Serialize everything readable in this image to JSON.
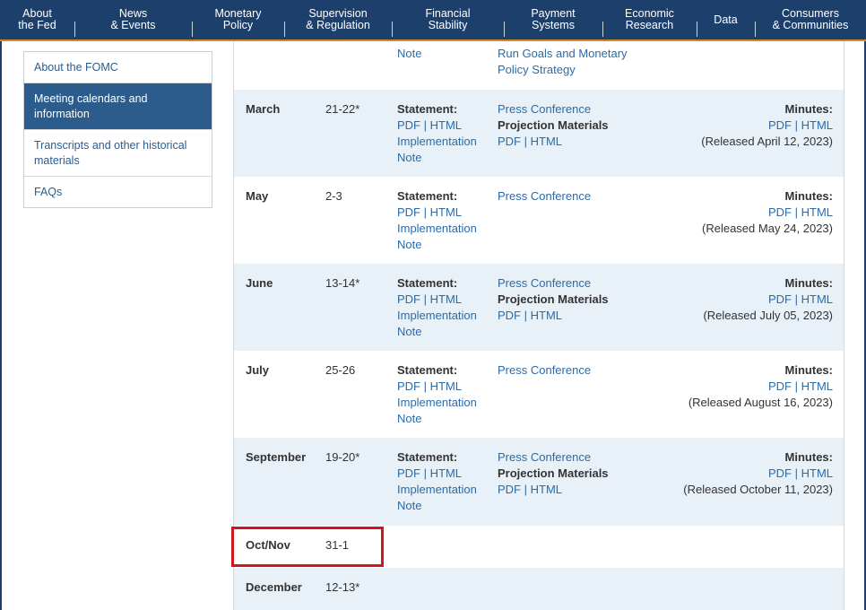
{
  "nav": [
    {
      "label": "About\nthe Fed"
    },
    {
      "label": "News\n& Events"
    },
    {
      "label": "Monetary\nPolicy"
    },
    {
      "label": "Supervision\n& Regulation"
    },
    {
      "label": "Financial\nStability"
    },
    {
      "label": "Payment\nSystems"
    },
    {
      "label": "Economic\nResearch"
    },
    {
      "label": "Data"
    },
    {
      "label": "Consumers\n& Communities"
    }
  ],
  "sidebar": {
    "items": [
      {
        "label": "About the FOMC"
      },
      {
        "label": "Meeting calendars and information"
      },
      {
        "label": "Transcripts and other historical materials"
      },
      {
        "label": "FAQs"
      }
    ]
  },
  "partial_row": {
    "stmt_line": "Note",
    "conf_lines": [
      "Run Goals and Monetary",
      "Policy Strategy"
    ]
  },
  "labels": {
    "statement": "Statement:",
    "minutes": "Minutes:",
    "pdf": "PDF",
    "html": "HTML",
    "sep": "|",
    "implementation": "Implementation",
    "note": "Note",
    "press_conference": "Press Conference",
    "projection_materials": "Projection Materials"
  },
  "meetings": [
    {
      "month": "March",
      "dates": "21-22*",
      "released": "(Released April 12, 2023)"
    },
    {
      "month": "May",
      "dates": "2-3",
      "released": "(Released May 24, 2023)"
    },
    {
      "month": "June",
      "dates": "13-14*",
      "released": "(Released July 05, 2023)"
    },
    {
      "month": "July",
      "dates": "25-26",
      "released": "(Released August 16, 2023)"
    },
    {
      "month": "September",
      "dates": "19-20*",
      "released": "(Released October 11, 2023)"
    },
    {
      "month": "Oct/Nov",
      "dates": "31-1"
    },
    {
      "month": "December",
      "dates": "12-13*"
    }
  ],
  "highlight_color": "#d0161b"
}
